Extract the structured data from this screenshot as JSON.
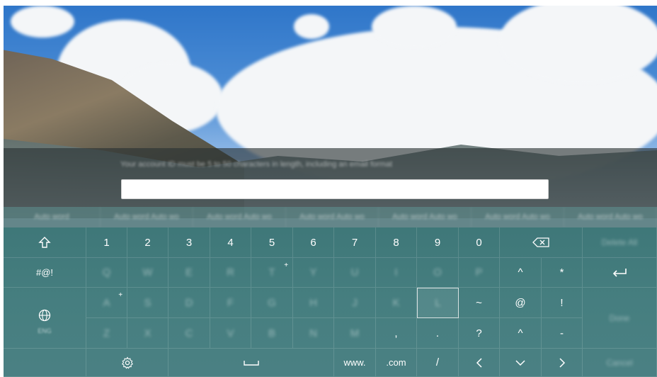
{
  "input": {
    "hint": "Your account ID must be 5 to 50 characters in length, including an email format",
    "value": ""
  },
  "suggestions": [
    "Auto word",
    "Auto word Auto wo",
    "Auto word Auto wo",
    "Auto word Auto wo",
    "Auto word Auto wo",
    "Auto word Auto wo",
    "Auto word Auto wo"
  ],
  "keys": {
    "row1": [
      "1",
      "2",
      "3",
      "4",
      "5",
      "6",
      "7",
      "8",
      "9",
      "0"
    ],
    "row2": [
      "Q",
      "W",
      "E",
      "R",
      "T",
      "Y",
      "U",
      "I",
      "O",
      "P",
      "^",
      "*"
    ],
    "row3": [
      "A",
      "S",
      "D",
      "F",
      "G",
      "H",
      "J",
      "K",
      "L",
      "~",
      "@",
      "!"
    ],
    "row4": [
      "Z",
      "X",
      "C",
      "V",
      "B",
      "N",
      "M",
      ",",
      ".",
      "?",
      "^",
      "-"
    ],
    "symbols_label": "#@!",
    "language_label": "ENG",
    "www_label": "www.",
    "com_label": ".com",
    "slash_label": "/",
    "delete_all_label": "Delete All",
    "done_label": "Done",
    "cancel_label": "Cancel"
  },
  "icons": {
    "shift": "shift-arrow-icon",
    "backspace": "backspace-icon",
    "enter": "enter-icon",
    "globe": "globe-icon",
    "settings": "gear-icon",
    "space": "space-bar-icon",
    "left": "chevron-left-icon",
    "down": "chevron-down-icon",
    "right": "chevron-right-icon"
  },
  "colors": {
    "keyboard_bg": "#3b7878",
    "selected_border": "#d8e2e2"
  }
}
